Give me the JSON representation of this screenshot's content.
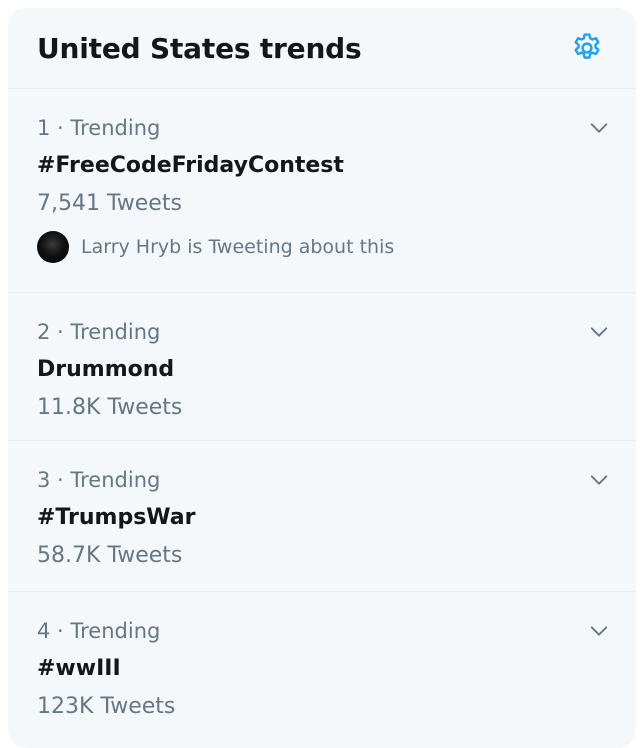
{
  "header": {
    "title": "United States trends"
  },
  "icons": {
    "settings": "gear-icon",
    "caret": "chevron-down-icon"
  },
  "colors": {
    "accent": "#1da1f2",
    "background": "#f5f8fa",
    "text_primary": "#14171a",
    "text_secondary": "#657786",
    "divider": "#e6ecf0"
  },
  "trends": [
    {
      "meta": "1 · Trending",
      "name": "#FreeCodeFridayContest",
      "count": "7,541 Tweets",
      "context": "Larry Hryb is Tweeting about this"
    },
    {
      "meta": "2 · Trending",
      "name": "Drummond",
      "count": "11.8K Tweets"
    },
    {
      "meta": "3 · Trending",
      "name": "#TrumpsWar",
      "count": "58.7K Tweets"
    },
    {
      "meta": "4 · Trending",
      "name": "#wwIII",
      "count": "123K Tweets"
    }
  ]
}
